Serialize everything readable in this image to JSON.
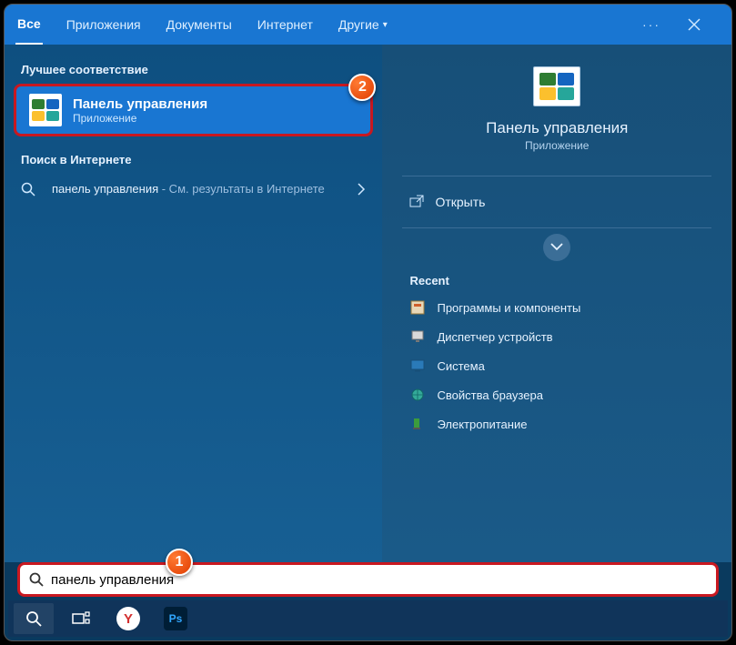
{
  "nav": {
    "tabs": [
      "Все",
      "Приложения",
      "Документы",
      "Интернет",
      "Другие"
    ]
  },
  "left": {
    "best_match_label": "Лучшее соответствие",
    "best_match": {
      "title": "Панель управления",
      "subtitle": "Приложение"
    },
    "web_label": "Поиск в Интернете",
    "web_result": {
      "query": "панель управления",
      "suffix": " - См. результаты в Интернете"
    }
  },
  "right": {
    "title": "Панель управления",
    "subtitle": "Приложение",
    "open_label": "Открыть",
    "recent_label": "Recent",
    "recent": [
      "Программы и компоненты",
      "Диспетчер устройств",
      "Система",
      "Свойства браузера",
      "Электропитание"
    ]
  },
  "search": {
    "value": "панель управления"
  },
  "annotations": {
    "badge1": "1",
    "badge2": "2"
  }
}
